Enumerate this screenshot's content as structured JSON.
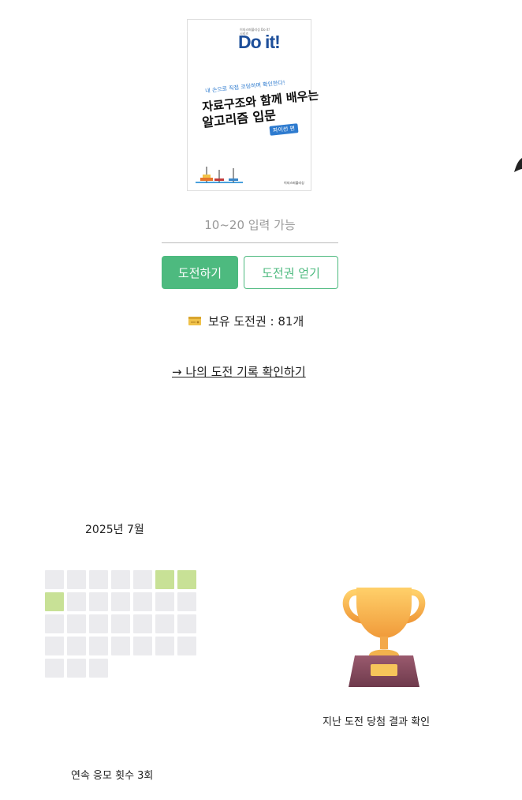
{
  "book": {
    "pub_small": "이지스퍼블리싱 Do it! 시리즈",
    "series": "Do it!",
    "tagline": "내 손으로 직접 코딩하며 확인한다!",
    "title_line1": "자료구조와 함께 배우는",
    "title_line2": "알고리즘 입문",
    "edition": "파이썬 편",
    "publisher": "이지스퍼블리싱"
  },
  "input": {
    "placeholder": "10~20 입력 가능"
  },
  "buttons": {
    "challenge": "도전하기",
    "get_ticket": "도전권 얻기"
  },
  "tickets": {
    "text": "보유 도전권 : 81개",
    "icon": "ticket-icon"
  },
  "history_link": "→ 나의 도전 기록 확인하기",
  "calendar": {
    "month_label": "2025년 7월",
    "cells": [
      0,
      0,
      0,
      0,
      0,
      1,
      1,
      1,
      0,
      0,
      0,
      0,
      0,
      0,
      0,
      0,
      0,
      0,
      0,
      0,
      0,
      0,
      0,
      0,
      0,
      0,
      0,
      0,
      0,
      0,
      0
    ]
  },
  "streak": "연속 응모 횟수 3회",
  "trophy": {
    "icon": "trophy-icon",
    "label": "지난 도전 당첨 결과 확인"
  },
  "colors": {
    "accent": "#4dba7f",
    "calendar_on": "#c8e196",
    "calendar_off": "#ebebee"
  }
}
